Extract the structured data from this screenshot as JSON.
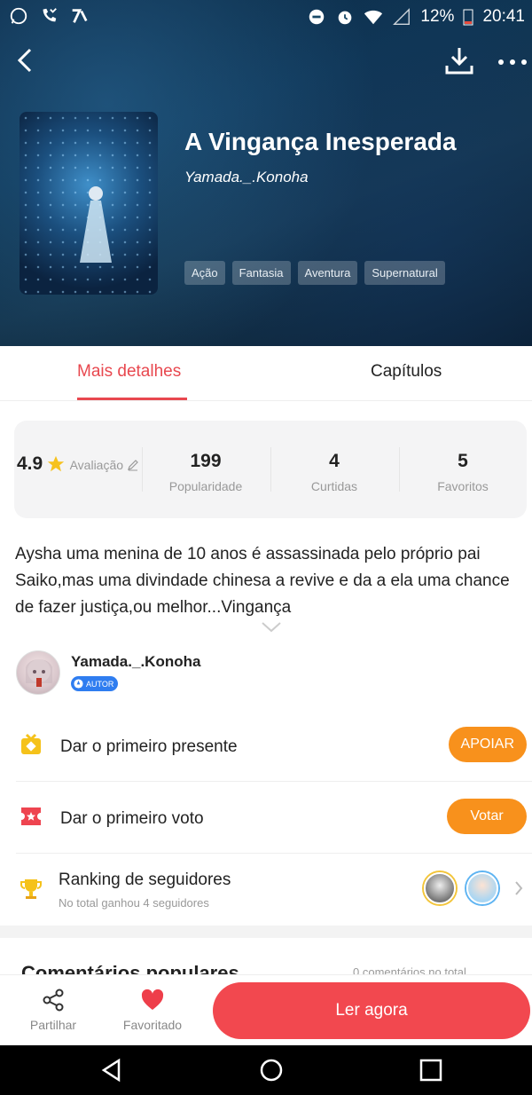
{
  "statusbar": {
    "battery": "12%",
    "time": "20:41"
  },
  "book": {
    "title": "A Vingança Inesperada",
    "author": "Yamada._.Konoha",
    "tags": [
      "Ação",
      "Fantasia",
      "Aventura",
      "Supernatural"
    ]
  },
  "tabs": {
    "details": "Mais detalhes",
    "chapters": "Capítulos"
  },
  "stats": [
    {
      "value": "4.9",
      "label": "Avaliação"
    },
    {
      "value": "199",
      "label": "Popularidade"
    },
    {
      "value": "4",
      "label": "Curtidas"
    },
    {
      "value": "5",
      "label": "Favoritos"
    }
  ],
  "synopsis": "Aysha uma menina de 10 anos é assassinada pelo próprio pai Saiko,mas uma divindade chinesa a revive e da a ela uma chance de fazer justiça,ou melhor...Vingança",
  "author_row": {
    "name": "Yamada._.Konoha",
    "badge": "AUTOR"
  },
  "gift": {
    "label": "Dar o primeiro presente",
    "button": "APOIAR"
  },
  "vote": {
    "label": "Dar o primeiro voto",
    "button": "Votar"
  },
  "ranking": {
    "label": "Ranking de seguidores",
    "sub": "No total ganhou 4 seguidores"
  },
  "comments": {
    "title": "Comentários populares",
    "count": "0 comentários no total"
  },
  "bottom": {
    "share": "Partilhar",
    "favorite": "Favoritado",
    "read": "Ler agora"
  },
  "colors": {
    "accent_red": "#e8484f",
    "button_orange": "#f8911c",
    "read_button": "#f2484f",
    "star": "#f6c21f"
  },
  "icons": {
    "back": "chevron-left-icon",
    "download": "download-icon",
    "more": "more-icon",
    "share": "share-icon",
    "favorite": "heart-icon",
    "gift": "gift-icon",
    "vote": "ticket-icon",
    "ranking": "trophy-icon"
  }
}
